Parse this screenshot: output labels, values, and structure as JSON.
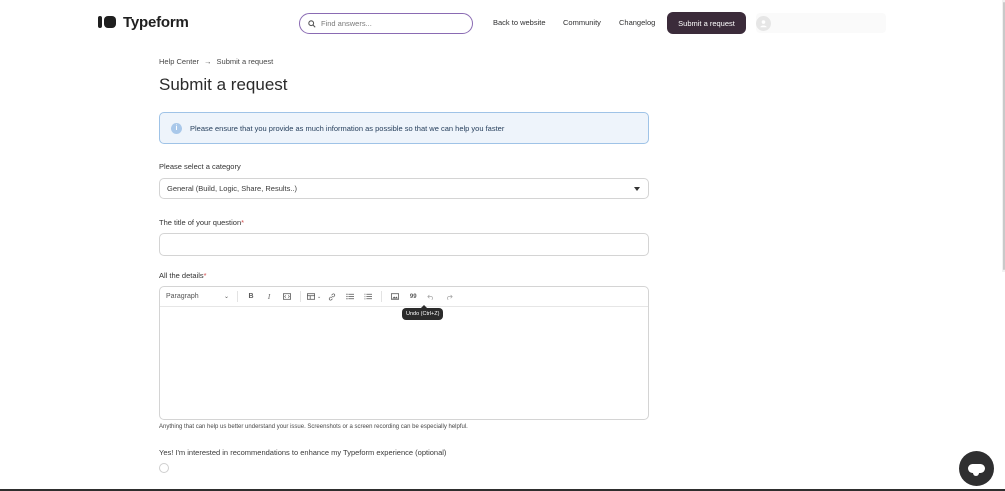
{
  "header": {
    "brand": "Typeform",
    "search_placeholder": "Find answers...",
    "nav": {
      "back": "Back to website",
      "community": "Community",
      "changelog": "Changelog"
    },
    "submit_label": "Submit a request",
    "user_email": ""
  },
  "breadcrumb": {
    "home": "Help Center",
    "separator": "→",
    "current": "Submit a request"
  },
  "page_title": "Submit a request",
  "notice": {
    "icon": "info-icon",
    "text": "Please ensure that you provide as much information as possible so that we can help you faster"
  },
  "form": {
    "category_label": "Please select a category",
    "category_value": "General (Build, Logic, Share, Results..)",
    "title_label": "The title of your question",
    "title_value": "",
    "details_label": "All the details",
    "required_mark": "*",
    "toolbar": {
      "paragraph": "Paragraph",
      "bold": "B",
      "italic": "I",
      "quote": "99"
    },
    "tooltip": "Undo (Ctrl+Z)",
    "helper": "Anything that can help us better understand your issue. Screenshots or a screen recording can be especially helpful.",
    "optin_label": "Yes! I'm interested in recommendations to enhance my Typeform experience (optional)"
  },
  "colors": {
    "primary_button": "#3b2b3a",
    "search_border": "#8a6bb3",
    "notice_bg": "#eef4fb",
    "notice_border": "#9fc3e7",
    "required": "#d44d4d"
  }
}
